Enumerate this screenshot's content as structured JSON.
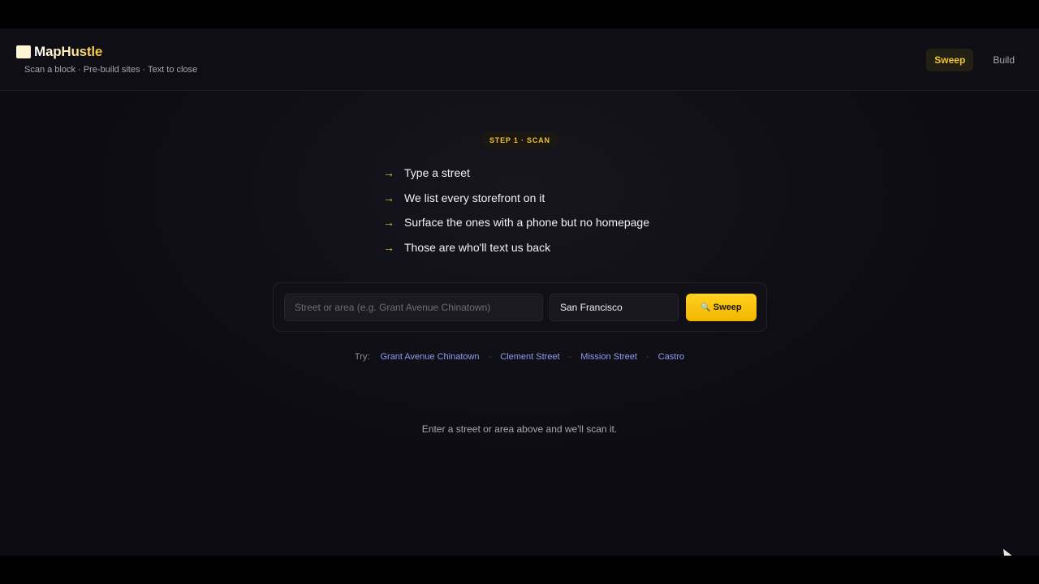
{
  "header": {
    "brand_name": "MapHustle",
    "tagline": "Scan a block · Pre-build sites · Text to close",
    "nav": [
      {
        "label": "Sweep",
        "active": true
      },
      {
        "label": "Build",
        "active": false
      }
    ]
  },
  "main": {
    "step_badge": "STEP 1 · SCAN",
    "steps": [
      "Type a street",
      "We list every storefront on it",
      "Surface the ones with a phone but no homepage",
      "Those are who'll text us back"
    ],
    "search": {
      "street_placeholder": "Street or area (e.g. Grant Avenue Chinatown)",
      "street_value": "",
      "city_value": "San Francisco",
      "button_label": "Sweep",
      "button_icon": "magnifier-icon"
    },
    "try": {
      "label": "Try:",
      "suggestions": [
        "Grant Avenue Chinatown",
        "Clement Street",
        "Mission Street",
        "Castro"
      ]
    },
    "empty_message": "Enter a street or area above and we'll scan it."
  },
  "colors": {
    "accent": "#f4c430",
    "link": "#8f9cf0",
    "background": "#0f0e14"
  }
}
